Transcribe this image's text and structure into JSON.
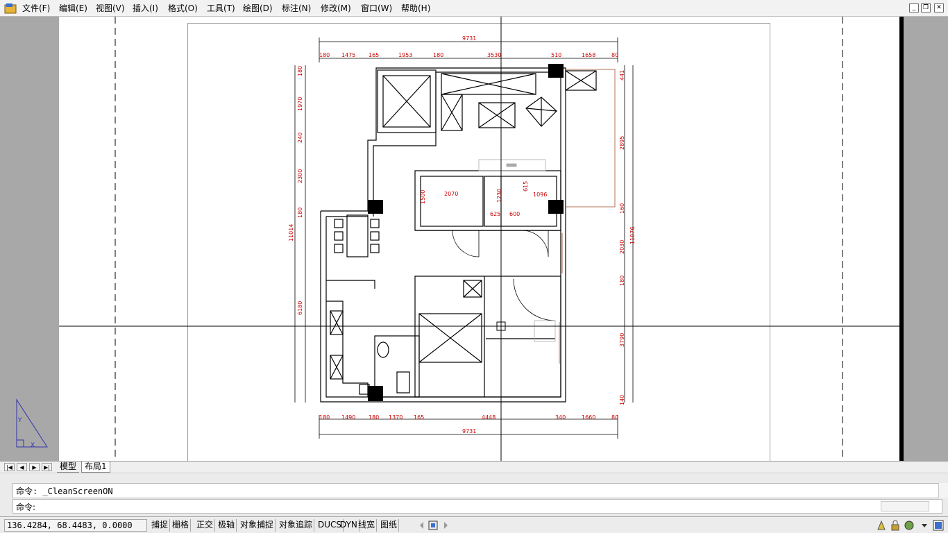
{
  "menubar": {
    "items": [
      {
        "label": "文件(F)"
      },
      {
        "label": "编辑(E)"
      },
      {
        "label": "视图(V)"
      },
      {
        "label": "插入(I)"
      },
      {
        "label": "格式(O)"
      },
      {
        "label": "工具(T)"
      },
      {
        "label": "绘图(D)"
      },
      {
        "label": "标注(N)"
      },
      {
        "label": "修改(M)"
      },
      {
        "label": "窗口(W)"
      },
      {
        "label": "帮助(H)"
      }
    ]
  },
  "drawing": {
    "dims_top": [
      "9731",
      "180",
      "1475",
      "165",
      "1953",
      "180",
      "3530",
      "510",
      "1658",
      "80"
    ],
    "dims_bottom": [
      "180",
      "1490",
      "180",
      "1370",
      "165",
      "4448",
      "340",
      "1660",
      "80",
      "9731"
    ],
    "dims_left": [
      "180",
      "1970",
      "240",
      "2300",
      "180",
      "11014",
      "6180"
    ],
    "dims_right": [
      "441",
      "2895",
      "160",
      "11076",
      "2030",
      "180",
      "3790",
      "140"
    ],
    "dims_inner": [
      "2070",
      "1500",
      "1230",
      "615",
      "1096",
      "625",
      "600"
    ],
    "colors": {
      "dimension": "#cc0000",
      "canvas": "#a8a8a8",
      "paper": "#ffffff",
      "walls": "#000000",
      "ucs": "#3333aa"
    }
  },
  "tabs": {
    "model": "模型",
    "layout": "布局1"
  },
  "command": {
    "history": "命令:  _CleanScreenON",
    "prompt": "命令:"
  },
  "status": {
    "coordinates": "136.4284, 68.4483, 0.0000",
    "buttons": [
      "捕捉",
      "栅格",
      "正交",
      "极轴",
      "对象捕捉",
      "对象追踪",
      "DUCS",
      "DYN",
      "线宽",
      "图纸"
    ]
  }
}
